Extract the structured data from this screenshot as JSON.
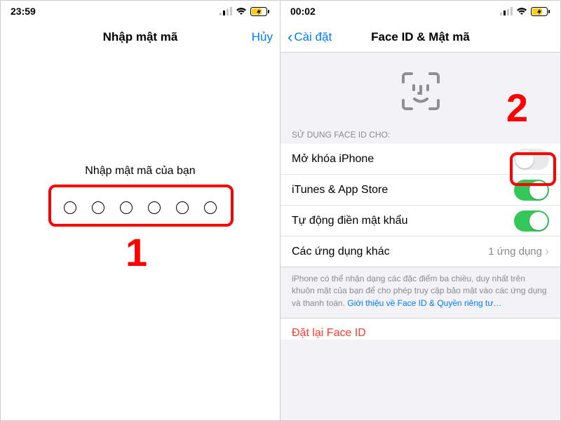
{
  "left": {
    "status_time": "23:59",
    "nav_title": "Nhập mật mã",
    "nav_cancel": "Hủy",
    "prompt": "Nhập mật mã của bạn",
    "annotation_number": "1"
  },
  "right": {
    "status_time": "00:02",
    "nav_back": "Cài đặt",
    "nav_title": "Face ID & Mật mã",
    "section_header": "SỬ DỤNG FACE ID CHO:",
    "rows": {
      "unlock": "Mở khóa iPhone",
      "itunes": "iTunes & App Store",
      "autofill": "Tự động điền mật khẩu",
      "other_apps": "Các ứng dụng khác",
      "other_apps_value": "1 ứng dụng"
    },
    "footer_text": "iPhone có thể nhận dạng các đặc điểm ba chiều, duy nhất trên khuôn mặt của bạn để cho phép truy cập bảo mật vào các ứng dụng và thanh toán. ",
    "footer_link": "Giới thiệu về Face ID & Quyền riêng tư…",
    "reset_label": "Đặt lại Face ID",
    "annotation_number": "2"
  }
}
